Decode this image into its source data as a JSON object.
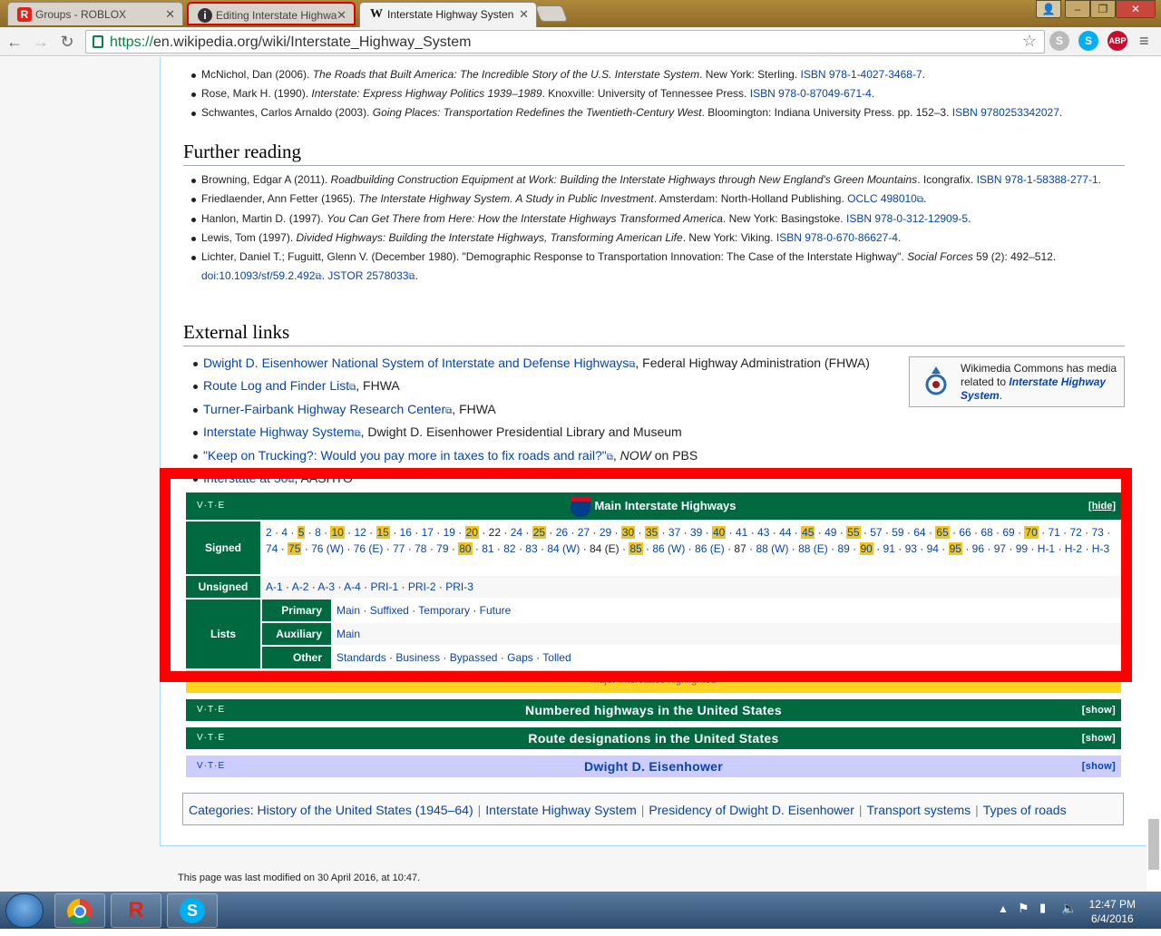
{
  "tabs": [
    {
      "label": "Groups - ROBLOX",
      "icon": "roblox-icon"
    },
    {
      "label": "Editing Interstate Highwa",
      "icon": "info-icon"
    },
    {
      "label": "Interstate Highway Systen",
      "icon": "wikipedia-icon"
    }
  ],
  "url": {
    "scheme": "https://",
    "rest": "en.wikipedia.org/wiki/Interstate_Highway_System"
  },
  "references": [
    {
      "text": "McNichol, Dan (2006). ",
      "title": "The Roads that Built America: The Incredible Story of the U.S. Interstate System",
      "after": ". New York: Sterling. ",
      "link": "ISBN 978-1-4027-3468-7",
      "end": "."
    },
    {
      "text": "Rose, Mark H. (1990). ",
      "title": "Interstate: Express Highway Politics 1939–1989",
      "after": ". Knoxville: University of Tennessee Press. ",
      "link": "ISBN 978-0-87049-671-4",
      "end": "."
    },
    {
      "text": "Schwantes, Carlos Arnaldo (2003). ",
      "title": "Going Places: Transportation Redefines the Twentieth-Century West",
      "after": ". Bloomington: Indiana University Press. pp. 152–3. ",
      "link": "ISBN 9780253342027",
      "end": "."
    }
  ],
  "further_heading": "Further reading",
  "further": [
    {
      "text": "Browning, Edgar A (2011). ",
      "title": "Roadbuilding Construction Equipment at Work: Building the Interstate Highways through New England's Green Mountains",
      "after": ". Icongrafix. ",
      "link": "ISBN 978-1-58388-277-1",
      "end": "."
    },
    {
      "text": "Friedlaender, Ann Fetter (1965). ",
      "title": "The Interstate Highway System. A Study in Public Investment",
      "after": ". Amsterdam: North-Holland Publishing. ",
      "link": "OCLC 498010",
      "end": "."
    },
    {
      "text": "Hanlon, Martin D. (1997). ",
      "title": "You Can Get There from Here: How the Interstate Highways Transformed America",
      "after": ". New York: Basingstoke. ",
      "link": "ISBN 978-0-312-12909-5",
      "end": "."
    },
    {
      "text": "Lewis, Tom (1997). ",
      "title": "Divided Highways: Building the Interstate Highways, Transforming American Life",
      "after": ". New York: Viking. ",
      "link": "ISBN 978-0-670-86627-4",
      "end": "."
    },
    {
      "text": "Lichter, Daniel T.; Fuguitt, Glenn V. (December 1980). \"Demographic Response to Transportation Innovation: The Case of the Interstate Highway\". ",
      "title": "Social Forces",
      "after": " 59 (2): 492–512. ",
      "link": "doi:10.1093/sf/59.2.492",
      "link2": "JSTOR 2578033",
      "end": "."
    }
  ],
  "external_heading": "External links",
  "external": [
    {
      "link": "Dwight D. Eisenhower National System of Interstate and Defense Highways",
      "after": ", Federal Highway Administration (FHWA)"
    },
    {
      "link": "Route Log and Finder List",
      "after": ", FHWA"
    },
    {
      "link": "Turner-Fairbank Highway Research Center",
      "after": ", FHWA"
    },
    {
      "link": "Interstate Highway System",
      "after": ", Dwight D. Eisenhower Presidential Library and Museum"
    },
    {
      "link": "\"Keep on Trucking?: Would you pay more in taxes to fix roads and rail?\"",
      "after": ", ",
      "em": "NOW",
      "after2": " on PBS"
    },
    {
      "link": "Interstate at 50",
      "after": ", AASHTO"
    }
  ],
  "commons": {
    "pre": "Wikimedia Commons has media related to ",
    "link": "Interstate Highway System",
    "end": "."
  },
  "navbox": {
    "vte": "V·T·E",
    "title": "Main Interstate Highways",
    "hide": "[hide]",
    "signed_label": "Signed",
    "signed": [
      [
        "2",
        0
      ],
      [
        "4",
        0
      ],
      [
        "5",
        1
      ],
      [
        "8",
        0
      ],
      [
        "10",
        1
      ],
      [
        "12",
        0
      ],
      [
        "15",
        1
      ],
      [
        "16",
        0
      ],
      [
        "17",
        0
      ],
      [
        "19",
        0
      ],
      [
        "20",
        1
      ],
      [
        "22",
        0
      ],
      [
        "24",
        0
      ],
      [
        "25",
        1
      ],
      [
        "26",
        0
      ],
      [
        "27",
        0
      ],
      [
        "29",
        0
      ],
      [
        "30",
        1
      ],
      [
        "35",
        1
      ],
      [
        "37",
        0
      ],
      [
        "39",
        0
      ],
      [
        "40",
        1
      ],
      [
        "41",
        0
      ],
      [
        "43",
        0
      ],
      [
        "44",
        0
      ],
      [
        "45",
        1
      ],
      [
        "49",
        0
      ],
      [
        "55",
        1
      ],
      [
        "57",
        0
      ],
      [
        "59",
        0
      ],
      [
        "64",
        0
      ],
      [
        "65",
        1
      ],
      [
        "66",
        0
      ],
      [
        "68",
        0
      ],
      [
        "69",
        0
      ],
      [
        "70",
        1
      ],
      [
        "71",
        0
      ],
      [
        "72",
        0
      ],
      [
        "73",
        0
      ],
      [
        "74",
        0
      ],
      [
        "75",
        1
      ],
      [
        "76 (W)",
        0
      ],
      [
        "76 (E)",
        0
      ],
      [
        "77",
        0
      ],
      [
        "78",
        0
      ],
      [
        "79",
        0
      ],
      [
        "80",
        1
      ],
      [
        "81",
        0
      ],
      [
        "82",
        0
      ],
      [
        "83",
        0
      ],
      [
        "84 (W)",
        0
      ],
      [
        "84 (E)",
        0
      ],
      [
        "85",
        1
      ],
      [
        "86 (W)",
        0
      ],
      [
        "86 (E)",
        0
      ],
      [
        "87",
        0
      ],
      [
        "88 (W)",
        0
      ],
      [
        "88 (E)",
        0
      ],
      [
        "89",
        0
      ],
      [
        "90",
        1
      ],
      [
        "91",
        0
      ],
      [
        "93",
        0
      ],
      [
        "94",
        0
      ],
      [
        "95",
        1
      ],
      [
        "96",
        0
      ],
      [
        "97",
        0
      ],
      [
        "99",
        0
      ],
      [
        "H-1",
        0
      ],
      [
        "H-2",
        0
      ],
      [
        "H-3",
        0
      ]
    ],
    "unsigned_label": "Unsigned",
    "unsigned": [
      "A-1",
      "A-2",
      "A-3",
      "A-4",
      "PRI-1",
      "PRI-2",
      "PRI-3"
    ],
    "lists_label": "Lists",
    "primary_label": "Primary",
    "primary": [
      "Main",
      "Suffixed",
      "Temporary",
      "Future"
    ],
    "auxiliary_label": "Auxiliary",
    "auxiliary": [
      "Main"
    ],
    "other_label": "Other",
    "other": [
      "Standards",
      "Business",
      "Bypassed",
      "Gaps",
      "Tolled"
    ]
  },
  "yellow_caption": "Major Interstates highlighted",
  "navbars": [
    {
      "title": "Numbered highways in the United States",
      "toggle": "[show]"
    },
    {
      "title": "Route designations in the United States",
      "toggle": "[show]"
    },
    {
      "title": "Dwight D. Eisenhower",
      "toggle": "[show]"
    }
  ],
  "categories": {
    "label": "Categories",
    "items": [
      "History of the United States (1945–64)",
      "Interstate Highway System",
      "Presidency of Dwight D. Eisenhower",
      "Transport systems",
      "Types of roads"
    ]
  },
  "footer": "This page was last modified on 30 April 2016, at 10:47.",
  "clock": {
    "time": "12:47 PM",
    "date": "6/4/2016"
  },
  "colors": {
    "navbox_green": "#016940",
    "highlight": "#f5c518",
    "link": "#0645ad",
    "annotation_red": "#ff0000"
  }
}
